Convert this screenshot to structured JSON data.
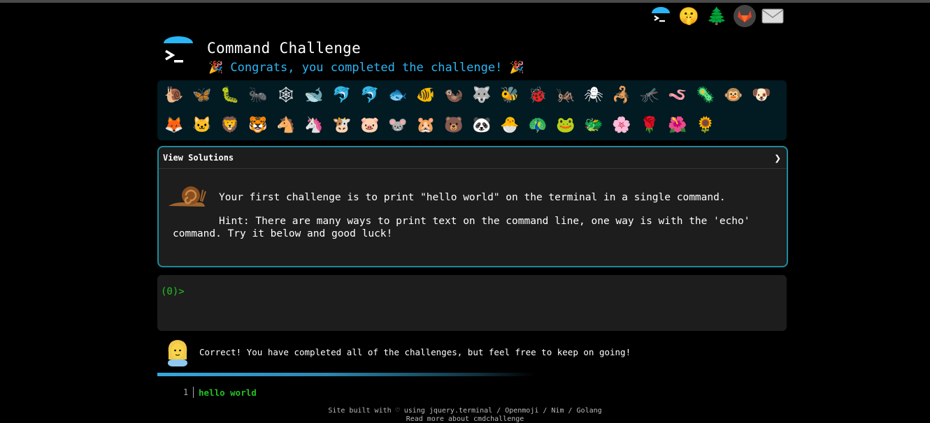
{
  "header": {
    "title": "Command Challenge",
    "congrats": "🎉 Congrats, you completed the challenge! 🎉"
  },
  "top_icons": [
    "terminal-logo-icon",
    "secret-face-icon",
    "tree-icon",
    "gitlab-icon",
    "envelope-icon"
  ],
  "top_icon_glyphs": {
    "secret": "🤫",
    "tree": "🌲",
    "envelope": "✉"
  },
  "critters": {
    "row1": [
      "🐌",
      "🦋",
      "🐛",
      "🐜",
      "🕸",
      "🐋",
      "🐬",
      "🐬",
      "🐟",
      "🐠",
      "🦦",
      "🐺",
      "🐝",
      "🐞",
      "🦗",
      "🕷",
      "🦂",
      "🦟",
      "🪱",
      "🦠",
      "🐵",
      "🐶"
    ],
    "row2": [
      "🦊",
      "🐱",
      "🦁",
      "🐯",
      "🐴",
      "🦄",
      "🐮",
      "🐷",
      "🐭",
      "🐹",
      "🐻",
      "🐼",
      "🐣",
      "🦚",
      "🐸",
      "🐲",
      "🌸",
      "🌹",
      "🌺",
      "🌻"
    ]
  },
  "solutions_panel": {
    "label": "View Solutions",
    "chevron": "❯",
    "challenge": "Your first challenge is to print \"hello world\" on the terminal in a single command.",
    "hint": "Hint: There are many ways to print text on the command line, one way is with the 'echo' command. Try it below and good luck!"
  },
  "terminal": {
    "prompt": "(0)>"
  },
  "result": {
    "message": "Correct! You have completed all of the challenges, but feel free to keep on going!",
    "progress": 0.6
  },
  "history": {
    "line_number": "1",
    "command": "hello world"
  },
  "footer": {
    "line1": "Site built with ♡ using jquery.terminal / Openmoji / Nim / Golang",
    "line2": "Read more about cmdchallenge"
  },
  "colors": {
    "accent": "#29b6f6",
    "prompt": "#22c322",
    "panel_border": "#1d8a9c"
  }
}
